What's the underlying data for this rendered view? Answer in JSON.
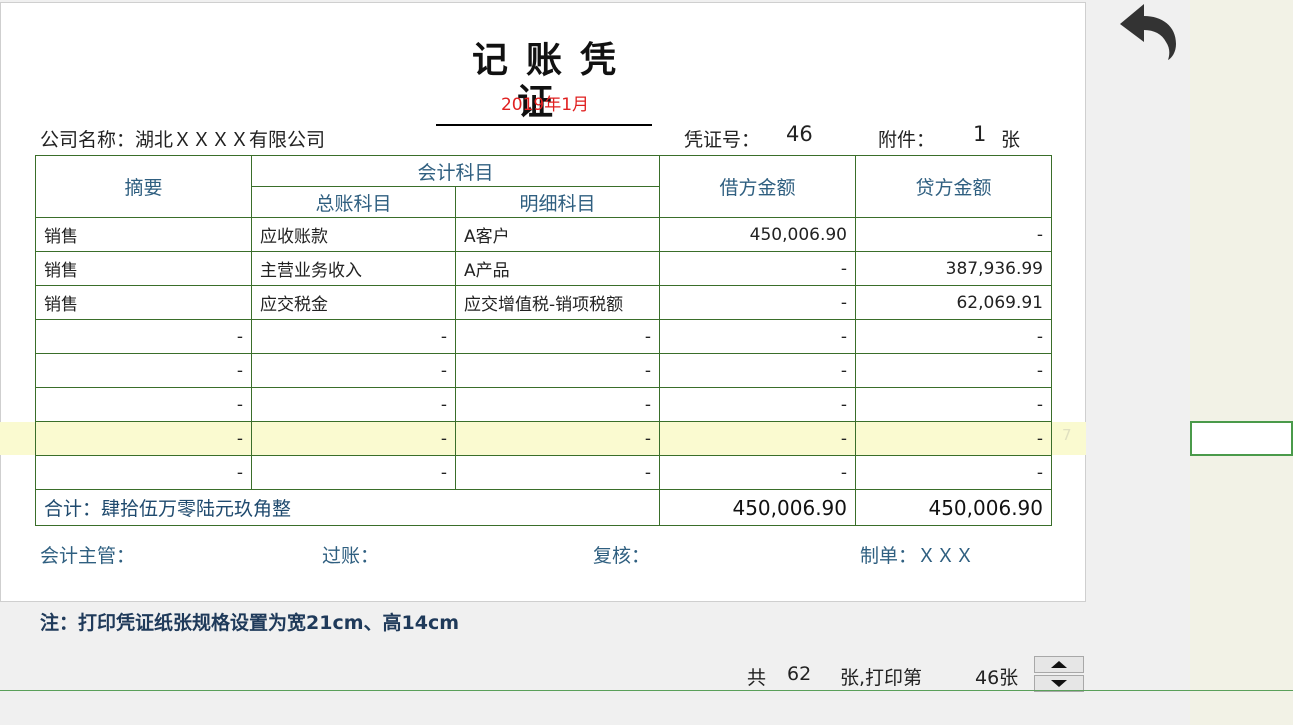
{
  "voucher": {
    "title": "记账凭证",
    "period": "2019年1月",
    "company": "公司名称：湖北ＸＸＸＸ有限公司",
    "voucher_no_label": "凭证号：",
    "voucher_no": "46",
    "attachment_label": "附件：",
    "attachment_count": "1",
    "attachment_unit": "张"
  },
  "table": {
    "headers": {
      "summary": "摘要",
      "account_group": "会计科目",
      "general_ledger": "总账科目",
      "detail": "明细科目",
      "debit": "借方金额",
      "credit": "贷方金额"
    },
    "rows": [
      {
        "summary": "销售",
        "general": "应收账款",
        "detail": "A客户",
        "debit": "450,006.90",
        "credit": "-"
      },
      {
        "summary": "销售",
        "general": "主营业务收入",
        "detail": "A产品",
        "debit": "-",
        "credit": "387,936.99"
      },
      {
        "summary": "销售",
        "general": "应交税金",
        "detail": "应交增值税-销项税额",
        "debit": "-",
        "credit": "62,069.91"
      },
      {
        "summary": "-",
        "general": "-",
        "detail": "-",
        "debit": "-",
        "credit": "-"
      },
      {
        "summary": "-",
        "general": "-",
        "detail": "-",
        "debit": "-",
        "credit": "-"
      },
      {
        "summary": "-",
        "general": "-",
        "detail": "-",
        "debit": "-",
        "credit": "-"
      },
      {
        "summary": "-",
        "general": "-",
        "detail": "-",
        "debit": "-",
        "credit": "-"
      },
      {
        "summary": "-",
        "general": "-",
        "detail": "-",
        "debit": "-",
        "credit": "-"
      }
    ],
    "total_label": "合计：肆拾伍万零陆元玖角整",
    "total_debit": "450,006.90",
    "total_credit": "450,006.90"
  },
  "signatures": {
    "supervisor": "会计主管：",
    "posting": "过账：",
    "review": "复核：",
    "preparer": "制单：ＸＸＸ"
  },
  "note": "注：打印凭证纸张规格设置为宽21cm、高14cm",
  "pager": {
    "total_prefix": "共",
    "total": "62",
    "middle": "张,打印第",
    "current": "46张"
  },
  "row_number": "7",
  "colors": {
    "border": "#3a6e2a",
    "header_text": "#2f5f80",
    "period": "#e02020",
    "highlight": "#fafad0"
  },
  "icons": {
    "back": "undo-arrow-icon",
    "spin_up": "chevron-up-icon",
    "spin_down": "chevron-down-icon"
  }
}
